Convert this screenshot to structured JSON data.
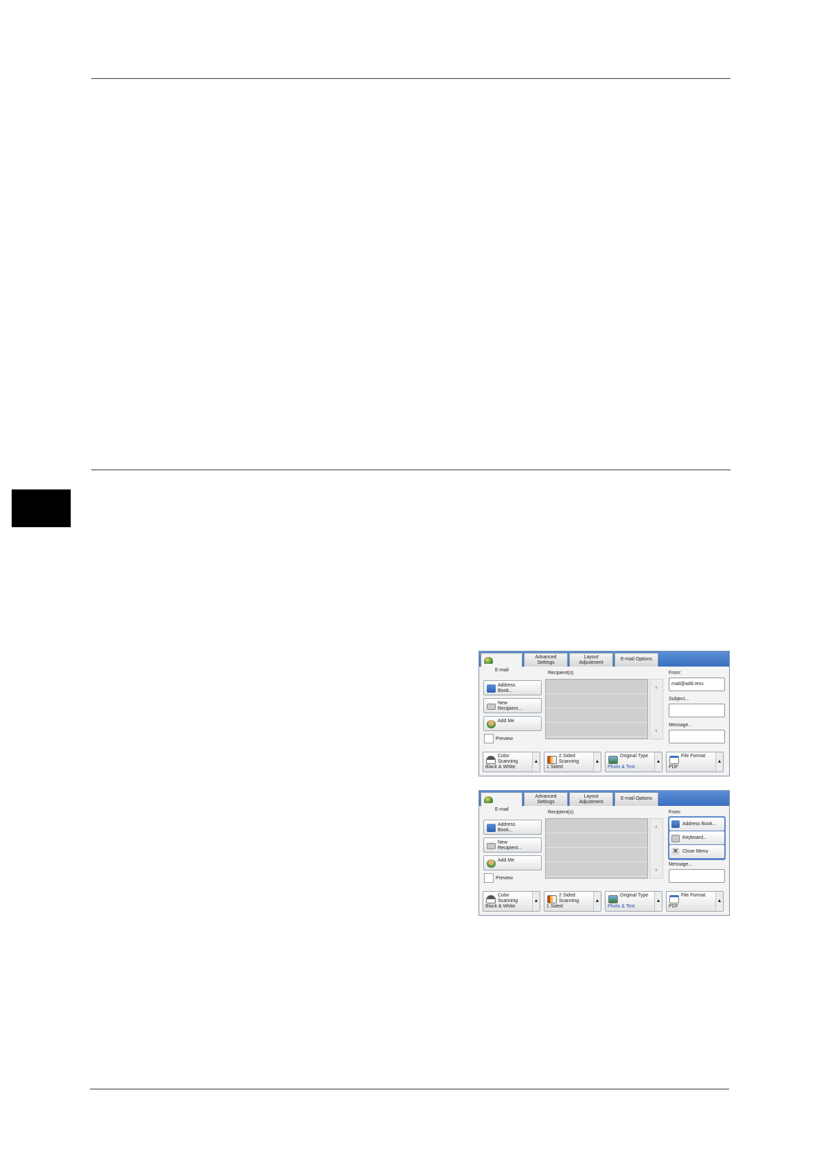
{
  "panel1": {
    "tabs": [
      "E-mail",
      "Advanced\nSettings",
      "Layout\nAdjustment",
      "E-mail Options"
    ],
    "recipients_label": "Recipient(s)",
    "buttons": [
      "Address\nBook...",
      "New\nRecipient...",
      "Add Me"
    ],
    "preview_label": "Preview",
    "from_label": "From:",
    "from_value": "mail@add.ress",
    "subject_label": "Subject...",
    "message_label": "Message...",
    "features": [
      {
        "title": "Color\nScanning",
        "value": "Black & White"
      },
      {
        "title": "2 Sided\nScanning",
        "value": "1 Sided"
      },
      {
        "title": "Original Type",
        "value": "Photo & Text"
      },
      {
        "title": "File Format",
        "value": "PDF"
      }
    ]
  },
  "panel2": {
    "tabs": [
      "E-mail",
      "Advanced\nSettings",
      "Layout\nAdjustment",
      "E-mail Options"
    ],
    "recipients_label": "Recipient(s)",
    "buttons": [
      "Address\nBook...",
      "New\nRecipient...",
      "Add Me"
    ],
    "preview_label": "Preview",
    "from_label": "From:",
    "menu": [
      "Address Book...",
      "Keyboard...",
      "Close Menu"
    ],
    "message_label": "Message...",
    "features": [
      {
        "title": "Color\nScanning",
        "value": "Black & White"
      },
      {
        "title": "2 Sided\nScanning",
        "value": "1 Sided"
      },
      {
        "title": "Original Type",
        "value": "Photo & Text"
      },
      {
        "title": "File Format",
        "value": "PDF"
      }
    ]
  }
}
